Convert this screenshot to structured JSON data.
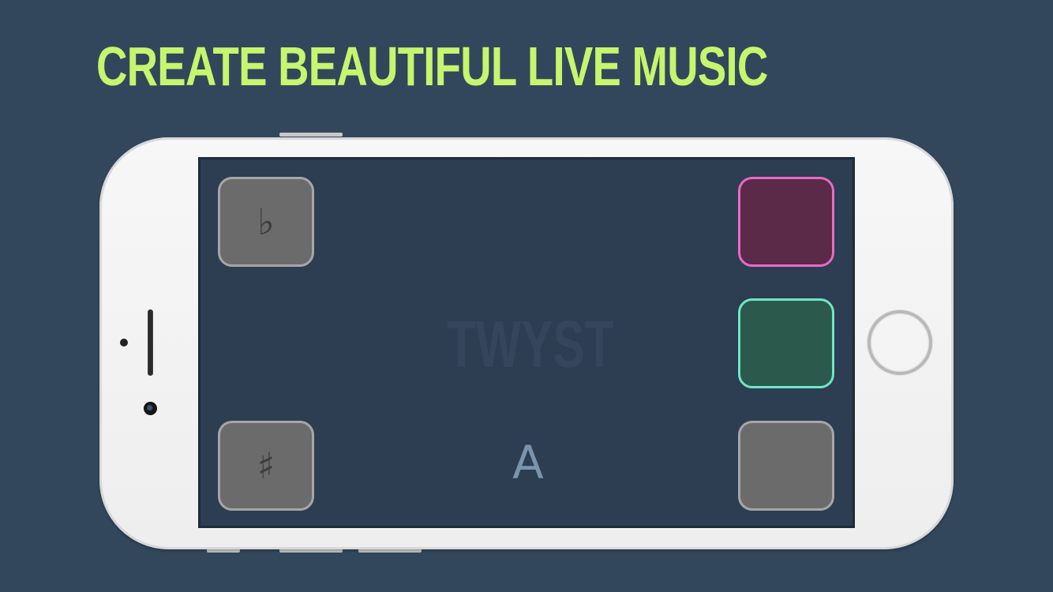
{
  "headline": "CREATE BEAUTIFUL LIVE MUSIC",
  "app": {
    "logo": "TWYST",
    "current_note": "A",
    "pads": {
      "flat": {
        "glyph": "♭",
        "icon": "flat-icon"
      },
      "sharp": {
        "glyph": "♯",
        "icon": "sharp-icon"
      },
      "pink": {
        "color": "#e86ac6"
      },
      "teal": {
        "color": "#6ee6c4"
      },
      "gray": {
        "color": "#a6a6a6"
      }
    }
  },
  "colors": {
    "background": "#32475c",
    "headline": "#c6f56e",
    "screen": "#2d3d52"
  }
}
